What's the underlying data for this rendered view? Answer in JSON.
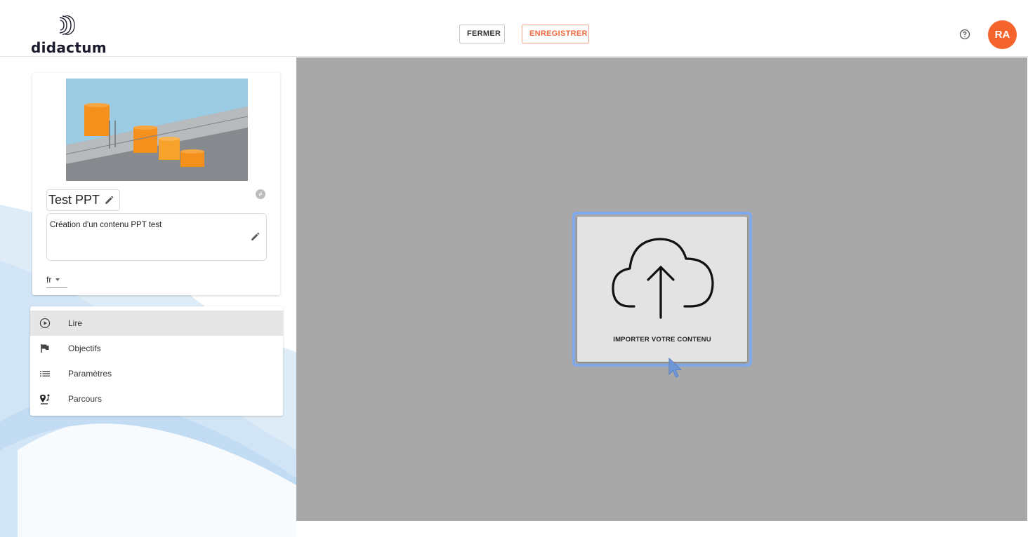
{
  "header": {
    "logo_text": "didactum",
    "close_label": "FERMER",
    "save_label": "ENREGISTRER",
    "help_icon": "help-circle-icon",
    "avatar_initials": "RA"
  },
  "content": {
    "title": "Test PPT",
    "hash_badge": "#",
    "description": "Création d'un contenu PPT test",
    "language": "fr"
  },
  "menu": {
    "items": [
      {
        "label": "Lire",
        "icon": "play-circle-icon",
        "active": true
      },
      {
        "label": "Objectifs",
        "icon": "flag-icon",
        "active": false
      },
      {
        "label": "Paramètres",
        "icon": "list-icon",
        "active": false
      },
      {
        "label": "Parcours",
        "icon": "route-icon",
        "active": false
      }
    ]
  },
  "upload": {
    "label": "IMPORTER VOTRE CONTENU",
    "icon": "cloud-upload-icon"
  },
  "colors": {
    "accent": "#f6642d",
    "focus_border": "#7fa9ea",
    "main_bg": "#a8a8a8"
  }
}
